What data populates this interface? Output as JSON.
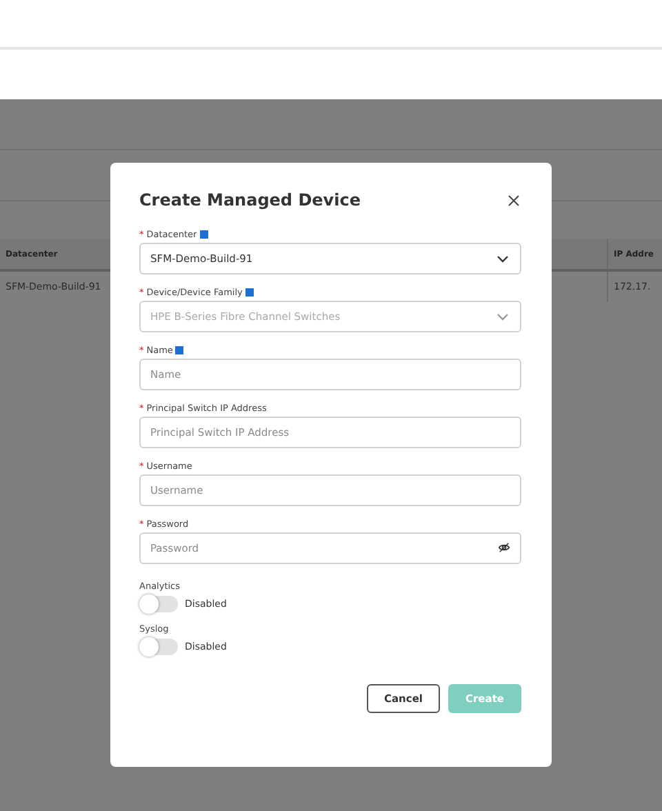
{
  "table": {
    "columns": [
      "Datacenter",
      "IP Addre"
    ],
    "rows": [
      [
        "SFM-Demo-Build-91",
        "172.17."
      ]
    ]
  },
  "dialog": {
    "title": "Create Managed Device",
    "fields": [
      {
        "kind": "select",
        "required_mark": "*",
        "label": "Datacenter",
        "info": true,
        "value": "SFM-Demo-Build-91",
        "disabled": false
      },
      {
        "kind": "select",
        "required_mark": "*",
        "label": "Device/Device Family",
        "info": true,
        "value": "HPE B-Series Fibre Channel Switches",
        "disabled": true
      },
      {
        "kind": "text",
        "required_mark": "*",
        "label": "Name",
        "info": true,
        "placeholder": "Name"
      },
      {
        "kind": "text",
        "required_mark": "*",
        "label": "Principal Switch IP Address",
        "placeholder": "Principal Switch IP Address"
      },
      {
        "kind": "text",
        "required_mark": "*",
        "label": "Username",
        "placeholder": "Username"
      },
      {
        "kind": "password",
        "required_mark": "*",
        "label": "Password",
        "placeholder": "Password"
      }
    ],
    "toggles": [
      {
        "label": "Analytics",
        "on": false,
        "state_text": "Disabled"
      },
      {
        "label": "Syslog",
        "on": false,
        "state_text": "Disabled"
      }
    ],
    "buttons": [
      {
        "kind": "secondary",
        "label": "Cancel"
      },
      {
        "kind": "primary",
        "label": "Create",
        "disabled": true
      }
    ]
  }
}
